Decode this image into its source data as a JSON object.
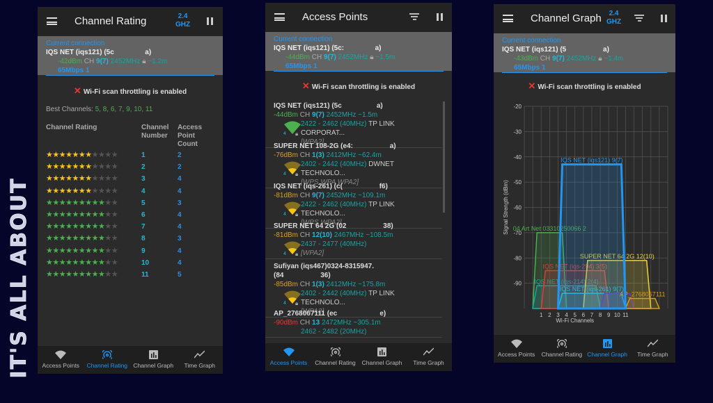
{
  "side_text": "IT'S ALL ABOUT",
  "common": {
    "current_connection": "Current connection",
    "throttle": "Wi-Fi scan throttling is enabled",
    "band": [
      "2.4",
      "GHZ"
    ],
    "nav": [
      {
        "label": "Access Points",
        "icon": "wifi-icon"
      },
      {
        "label": "Channel Rating",
        "icon": "signal-target-icon"
      },
      {
        "label": "Channel Graph",
        "icon": "bar-chart-icon"
      },
      {
        "label": "Time Graph",
        "icon": "line-graph-icon"
      }
    ]
  },
  "rating": {
    "title": "Channel Rating",
    "conn": {
      "name": "IQS NET (iqs121) (5c                a)",
      "dbm": "-42dBm",
      "ch_label": "CH",
      "ch": "9(7)",
      "freq": "2452MHz",
      "dist": "~1.2m",
      "speed": "65Mbps 1"
    },
    "best_label": "Best Channels:",
    "best": "5, 8, 6, 7, 9, 10, 11",
    "headers": [
      "Channel Rating",
      "Channel Number",
      "Access Point Count"
    ],
    "max_stars": 11,
    "rows": [
      {
        "stars": 7,
        "color": "#f5c518",
        "ch": "1",
        "count": "2"
      },
      {
        "stars": 7,
        "color": "#f5c518",
        "ch": "2",
        "count": "2"
      },
      {
        "stars": 7,
        "color": "#f5c518",
        "ch": "3",
        "count": "4"
      },
      {
        "stars": 7,
        "color": "#f5c518",
        "ch": "4",
        "count": "4"
      },
      {
        "stars": 9,
        "color": "#4caf50",
        "ch": "5",
        "count": "3"
      },
      {
        "stars": 9,
        "color": "#4caf50",
        "ch": "6",
        "count": "4"
      },
      {
        "stars": 9,
        "color": "#4caf50",
        "ch": "7",
        "count": "4"
      },
      {
        "stars": 9,
        "color": "#4caf50",
        "ch": "8",
        "count": "3"
      },
      {
        "stars": 9,
        "color": "#4caf50",
        "ch": "9",
        "count": "4"
      },
      {
        "stars": 9,
        "color": "#4caf50",
        "ch": "10",
        "count": "4"
      },
      {
        "stars": 9,
        "color": "#4caf50",
        "ch": "11",
        "count": "5"
      }
    ],
    "active_nav": 1
  },
  "aps": {
    "title": "Access Points",
    "conn": {
      "name": "IQS NET (iqs121) (5c:                a)",
      "dbm": "-44dBm",
      "ch_label": "CH",
      "ch": "9(7)",
      "freq": "2452MHz",
      "dist": "~1.5m",
      "speed": "65Mbps 1"
    },
    "items": [
      {
        "name": "IQS NET (iqs121) (5c                  a)",
        "dbm": "-44dBm",
        "level": "g",
        "ch": "9(7)",
        "freq": "2452MHz ~1.5m",
        "range": "2422 - 2462 (40MHz)",
        "vendor": "TP LINK CORPORAT...",
        "security": "[WPA2]",
        "wifi_color": "#4caf50"
      },
      {
        "name": "SUPER NET 108-2G (e4:                   a)",
        "dbm": "-76dBm",
        "level": "y",
        "ch": "1(3)",
        "freq": "2412MHz ~62.4m",
        "range": "2402 - 2442 (40MHz)",
        "vendor": "DWNET TECHNOLO...",
        "security": "[WPS WPA WPA2]",
        "wifi_color": "#f5c518"
      },
      {
        "name": "IQS NET (iqs-261) (c(                   f6)",
        "dbm": "-81dBm",
        "level": "y",
        "ch": "9(7)",
        "freq": "2452MHz ~109.1m",
        "range": "2422 - 2462 (40MHz)",
        "vendor": "TP LINK TECHNOLO...",
        "security": "[WPS WPA2]",
        "wifi_color": "#f5c518"
      },
      {
        "name": "SUPER NET 64 2G (02                   38)",
        "dbm": "-81dBm",
        "level": "y",
        "ch": "12(10)",
        "freq": "2467MHz ~108.5m",
        "range": "2437 - 2477 (40MHz)",
        "vendor": "",
        "security": "[WPA2]",
        "wifi_color": "#f5c518"
      },
      {
        "name": "Sufiyan (iqs467)0324-8315947.\n(84                   36)",
        "dbm": "-85dBm",
        "level": "y",
        "ch": "1(3)",
        "freq": "2412MHz ~175.8m",
        "range": "2402 - 2442 (40MHz)",
        "vendor": "TP LINK TECHNOLO...",
        "security": "[WPA2]",
        "wifi_color": "#f5c518"
      },
      {
        "name": "AP_2768067111 (ec                      e)",
        "dbm": "-90dBm",
        "level": "r",
        "ch": "13",
        "freq": "2472MHz ~305.1m",
        "range": "2462 - 2482 (20MHz)",
        "vendor": "",
        "security": "",
        "wifi_color": "#e53935"
      }
    ],
    "active_nav": 0
  },
  "graph": {
    "title": "Channel Graph",
    "conn": {
      "name": "IQS NET (iqs121) (5                   a)",
      "dbm": "-43dBm",
      "ch_label": "CH",
      "ch": "9(7)",
      "freq": "2452MHz",
      "dist": "~1.4m",
      "speed": "65Mbps 1"
    },
    "active_nav": 2
  },
  "chart_data": {
    "type": "area",
    "xlabel": "Wi-Fi Channels",
    "ylabel": "Signal Strength (dBm)",
    "xlim": [
      -1,
      16
    ],
    "ylim": [
      -100,
      -20
    ],
    "yticks": [
      -20,
      -30,
      -40,
      -50,
      -60,
      -70,
      -80,
      -90
    ],
    "xticks": [
      1,
      2,
      3,
      4,
      5,
      6,
      7,
      8,
      9,
      10,
      11
    ],
    "grid": true,
    "series": [
      {
        "name": "04 Art Net 03310250066 2",
        "center": 2,
        "width_mhz": 20,
        "dbm": -70,
        "color": "#4caf50"
      },
      {
        "name": "IQS NET (iqs-214) 2(4)",
        "center": 4,
        "width_mhz": 40,
        "dbm": -91,
        "color": "#16a5a0"
      },
      {
        "name": "IQS NET (iqs-294) 3(5)",
        "center": 5,
        "width_mhz": 40,
        "dbm": -85,
        "color": "#e53935"
      },
      {
        "name": "SUPER NET 64 2G 12(10)",
        "center": 10,
        "width_mhz": 40,
        "dbm": -81,
        "color": "#f0d43a"
      },
      {
        "name": "IQS NET (iqs-261) 9(7)",
        "center": 7,
        "width_mhz": 40,
        "dbm": -94,
        "color": "#26c6da"
      },
      {
        "name": "",
        "center": 10,
        "width_mhz": 20,
        "dbm": -94,
        "color": "#673ab7"
      },
      {
        "name": "AP_2768067111",
        "center": 13,
        "width_mhz": 20,
        "dbm": -96,
        "color": "#d4a017"
      },
      {
        "name": "IQS NET (iqs121) 9(7)",
        "center": 7,
        "width_mhz": 40,
        "dbm": -43,
        "color": "#2196f3"
      }
    ]
  }
}
